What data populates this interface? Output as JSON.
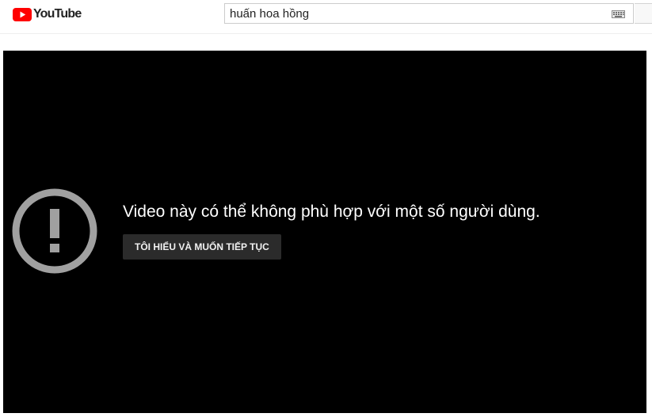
{
  "header": {
    "logo_text": "YouTube",
    "brand_color": "#FF0000",
    "search": {
      "value": "huấn hoa hồng",
      "keyboard_icon": "keyboard-icon"
    }
  },
  "player": {
    "background": "#000000",
    "warning_icon": "exclamation-circle-icon",
    "message": "Video này có thể không phù hợp với một số người dùng.",
    "continue_label": "TÔI HIỂU VÀ MUỐN TIẾP TỤC"
  }
}
